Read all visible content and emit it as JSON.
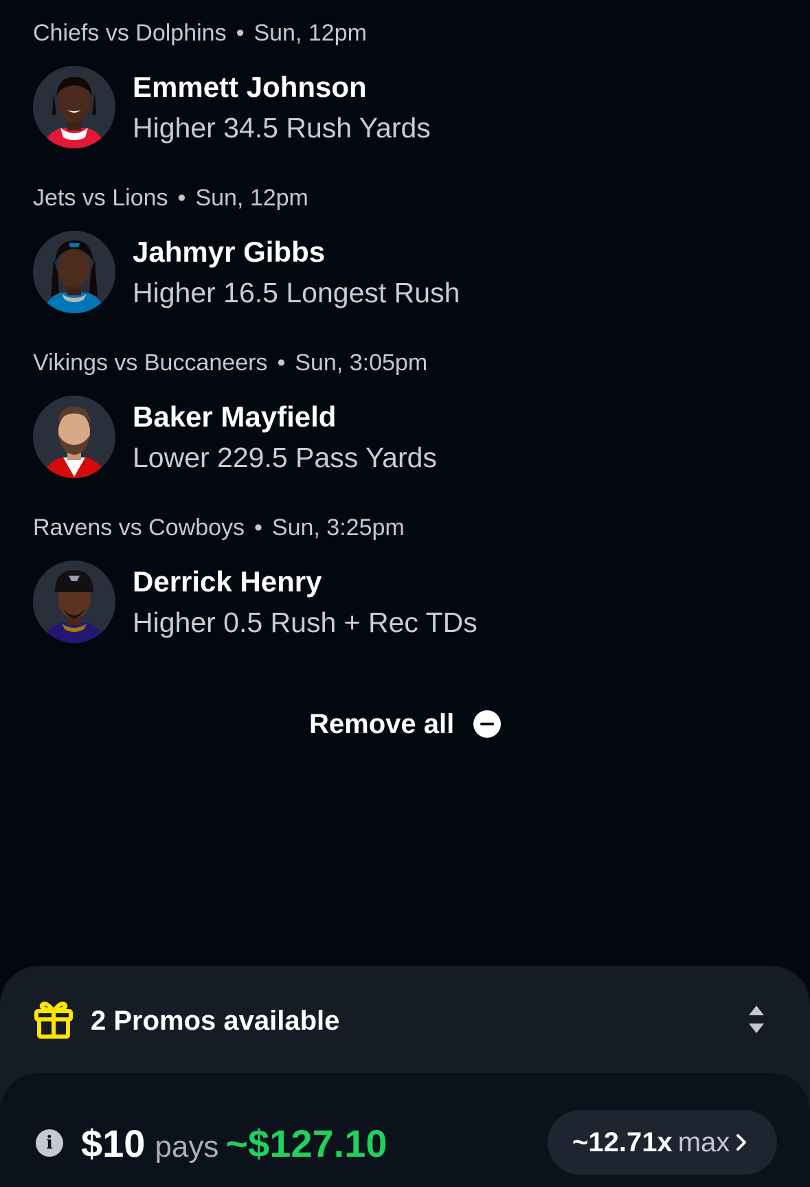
{
  "picks": [
    {
      "game": "Chiefs vs Dolphins",
      "time": "Sun, 12pm",
      "player": "Emmett Johnson",
      "line": "Higher 34.5 Rush Yards",
      "avatar_colors": {
        "skin": "#4a2a1c",
        "jersey": "#e31837",
        "collar": "#ffffff"
      }
    },
    {
      "game": "Jets vs Lions",
      "time": "Sun, 12pm",
      "player": "Jahmyr Gibbs",
      "line": "Higher 16.5 Longest Rush",
      "avatar_colors": {
        "skin": "#4b2c1d",
        "jersey": "#0076b6",
        "collar": "#b0b7bc"
      }
    },
    {
      "game": "Vikings vs Buccaneers",
      "time": "Sun, 3:05pm",
      "player": "Baker Mayfield",
      "line": "Lower 229.5 Pass Yards",
      "avatar_colors": {
        "skin": "#d8a987",
        "jersey": "#d50a0a",
        "collar": "#ffffff"
      }
    },
    {
      "game": "Ravens vs Cowboys",
      "time": "Sun, 3:25pm",
      "player": "Derrick Henry",
      "line": "Higher 0.5 Rush + Rec TDs",
      "avatar_colors": {
        "skin": "#5a3322",
        "jersey": "#241773",
        "collar": "#9e7c0c"
      }
    }
  ],
  "remove_all": {
    "label": "Remove all",
    "icon": "minus-circle-icon"
  },
  "promos": {
    "label": "2 Promos available",
    "icon": "gift-icon",
    "toggle_icon": "sort-icon",
    "icon_color": "#ffe600"
  },
  "payout": {
    "stake": "$10",
    "pays_word": "pays",
    "amount": "~$127.10",
    "amount_color": "#1fd15e",
    "multiplier": "~12.71x",
    "multiplier_suffix": "max",
    "info_icon": "info-icon",
    "chevron_icon": "chevron-right-icon"
  }
}
